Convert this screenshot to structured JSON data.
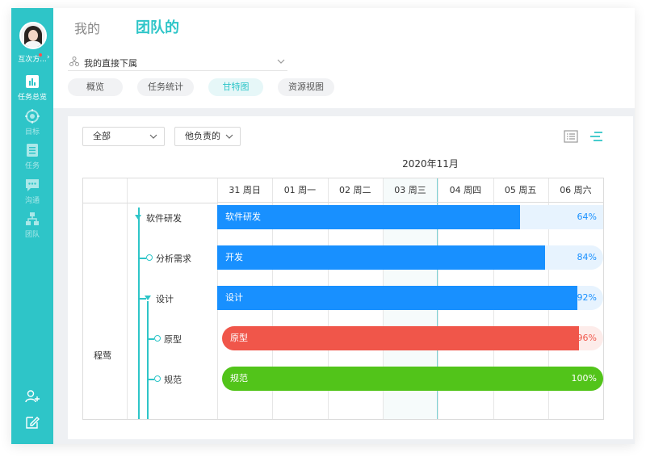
{
  "sidebar": {
    "user_name": "互次方...",
    "items": [
      {
        "label": "任务总览",
        "icon": "bar-chart-icon",
        "active": true
      },
      {
        "label": "目标",
        "icon": "target-icon",
        "active": false
      },
      {
        "label": "任务",
        "icon": "task-list-icon",
        "active": false
      },
      {
        "label": "沟通",
        "icon": "chat-icon",
        "active": false
      },
      {
        "label": "团队",
        "icon": "org-chart-icon",
        "active": false
      }
    ],
    "bottom_icons": [
      "add-user-icon",
      "edit-icon"
    ]
  },
  "header": {
    "tabs": [
      {
        "label": "我的",
        "active": false
      },
      {
        "label": "团队的",
        "active": true
      }
    ]
  },
  "subheader": {
    "scope_select": "我的直接下属",
    "view_tabs": [
      {
        "label": "概览",
        "active": false
      },
      {
        "label": "任务统计",
        "active": false
      },
      {
        "label": "甘特图",
        "active": true
      },
      {
        "label": "资源视图",
        "active": false
      }
    ]
  },
  "filters": {
    "status": "全部",
    "responsibility": "他负责的"
  },
  "gantt": {
    "month": "2020年11月",
    "days": [
      "31 周日",
      "01 周一",
      "02 周二",
      "03 周三",
      "04 周四",
      "05 周五",
      "06 周六"
    ],
    "today_index": 3,
    "person": "程莺",
    "tasks": [
      {
        "name": "软件研发",
        "level": 0,
        "type": "group",
        "bar_label": "软件研发",
        "progress": 64,
        "pct_text": "64%",
        "color": "#1890ff",
        "track": "#e7f3fe",
        "pct_color": "#1890ff"
      },
      {
        "name": "分析需求",
        "level": 1,
        "type": "leaf",
        "bar_label": "开发",
        "progress": 84,
        "pct_text": "84%",
        "color": "#1890ff",
        "track": "#e7f3fe",
        "pct_color": "#1890ff"
      },
      {
        "name": "设计",
        "level": 1,
        "type": "group",
        "bar_label": "设计",
        "progress": 92,
        "pct_text": "92%",
        "color": "#1890ff",
        "track": "#e7f3fe",
        "pct_color": "#1890ff"
      },
      {
        "name": "原型",
        "level": 2,
        "type": "leaf",
        "bar_label": "原型",
        "progress": 96,
        "pct_text": "96%",
        "color": "#f0564a",
        "track": "#fdecea",
        "pct_color": "#f0564a"
      },
      {
        "name": "规范",
        "level": 2,
        "type": "leaf",
        "bar_label": "规范",
        "progress": 100,
        "pct_text": "100%",
        "color": "#52c41a",
        "track": "#eaf7e3",
        "pct_color": "#ffffff"
      }
    ]
  }
}
